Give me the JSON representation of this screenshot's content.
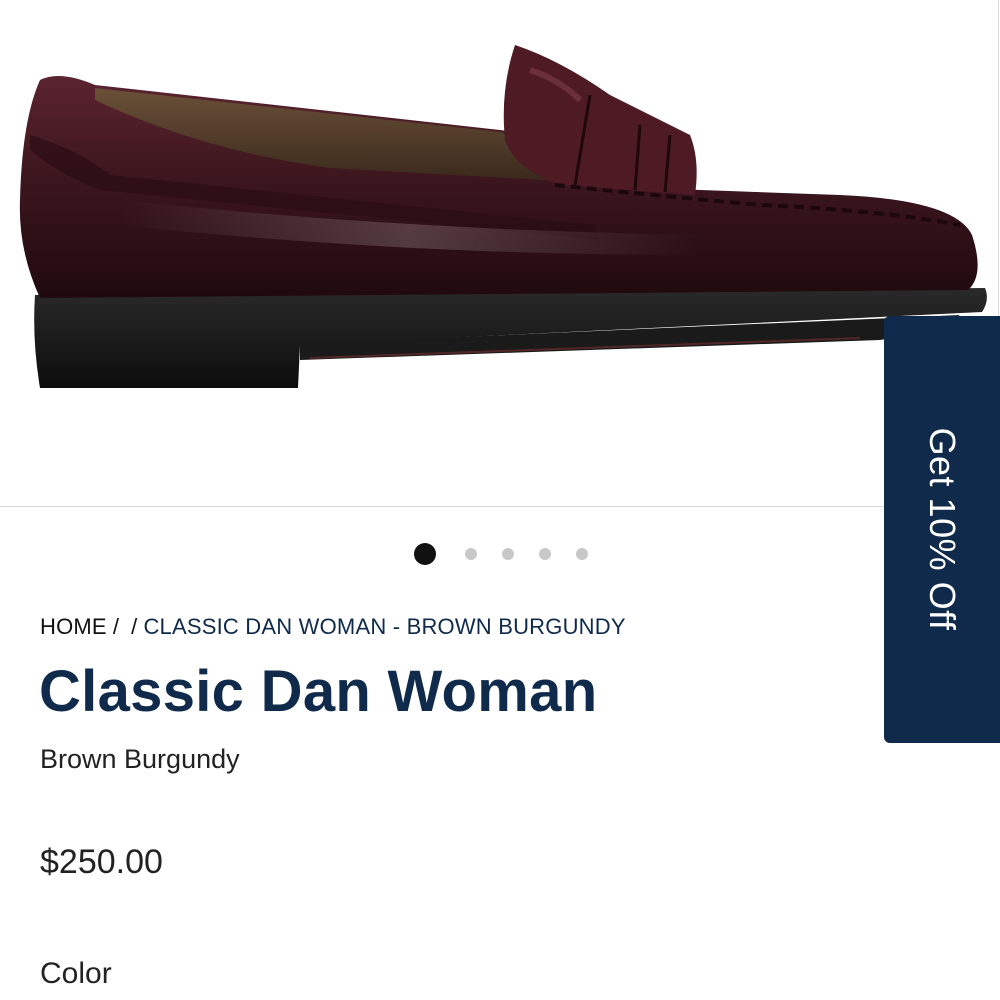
{
  "gallery": {
    "image_alt": "Classic Dan Woman loafer in brown burgundy leather",
    "slide_count": 5,
    "active_slide": 1
  },
  "breadcrumb": {
    "home": "HOME",
    "separator": "/",
    "current": "CLASSIC DAN WOMAN - BROWN BURGUNDY"
  },
  "product": {
    "title": "Classic Dan Woman",
    "color_name": "Brown Burgundy",
    "price": "$250.00",
    "color_label": "Color"
  },
  "promo": {
    "label": "Get 10% Off"
  },
  "colors": {
    "brand_navy": "#0f2a4a",
    "leather_burgundy": "#4a1c24",
    "dot_active": "#111111",
    "dot_inactive": "#c8c8c8"
  }
}
